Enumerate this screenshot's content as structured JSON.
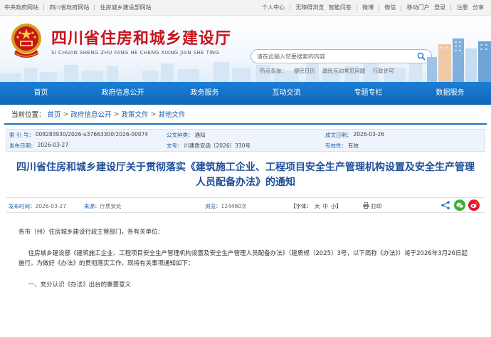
{
  "topbar": {
    "left_links": [
      "中央政府网站",
      "四川省政府网站",
      "住房城乡建设部网站"
    ],
    "right_links": [
      "个人中心",
      "无障碍浏览",
      "智能问答",
      "微博",
      "微信",
      "移动门户",
      "登录",
      "注册",
      "分享"
    ]
  },
  "header": {
    "title": "四川省住房和城乡建设厅",
    "pinyin": "SI CHUAN SHENG ZHU FANG HE CHENG XIANG JIAN SHE TING",
    "search_placeholder": "请在此输入您要搜索的内容",
    "hot_label": "热点查询：",
    "hot_links": [
      "便民日历",
      "政民互动常见问题",
      "行政许可"
    ]
  },
  "nav": {
    "items": [
      "首页",
      "政府信息公开",
      "政务服务",
      "互动交流",
      "专题专栏",
      "数据服务"
    ]
  },
  "breadcrumb": {
    "label": "当前位置：",
    "items": [
      "首页",
      "政府信息公开",
      "政策文件",
      "其他文件"
    ],
    "separator": ">"
  },
  "meta": {
    "index_no_label": "索 引 号：",
    "index_no": "008283930/2026-u37663300/2026-00074",
    "category_label": "公文种类：",
    "category": "通知",
    "created_label": "成文日期：",
    "created": "2026-03-26",
    "published_label": "发布日期：",
    "published": "2026-03-27",
    "doc_no_label": "文号：",
    "doc_no": "川建质安函〔2026〕330号",
    "validity_label": "有效性：",
    "validity": "有效"
  },
  "article": {
    "title": "四川省住房和城乡建设厅关于贯彻落实《建筑施工企业、工程项目安全生产管理机构设置及安全生产管理人员配备办法》的通知",
    "publish_time_label": "发布时间：",
    "publish_time": "2026-03-27",
    "source_label": "来源：",
    "source": "厅质安处",
    "views_label": "浏览：",
    "views": "124460次",
    "font_label": "【字体：",
    "font_sizes": [
      "大",
      "中",
      "小"
    ],
    "font_close": "】",
    "print_label": "打印",
    "paragraphs": [
      "各市（州）住房城乡建设行政主管部门，各有关单位：",
      "住房城乡建设部《建筑施工企业、工程项目安全生产管理机构设置及安全生产管理人员配备办法》（建质规〔2025〕3号，以下简称《办法》）将于2026年3月26日起施行。为做好《办法》的贯彻落实工作，现将有关事项通知如下：",
      "一、充分认识《办法》出台的重要意义"
    ]
  },
  "colors": {
    "brand_red": "#c8141b",
    "nav_blue": "#1570c5",
    "title_blue": "#1f4f99",
    "link_blue": "#1f5fa8"
  }
}
